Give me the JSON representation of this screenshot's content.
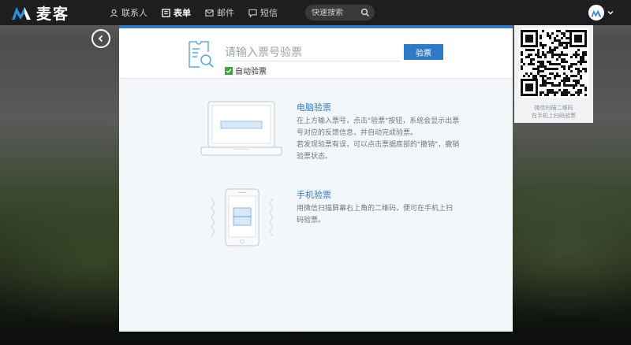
{
  "brand": {
    "name": "麦客"
  },
  "nav": [
    {
      "label": "联系人",
      "icon": "user-icon",
      "active": false
    },
    {
      "label": "表单",
      "icon": "form-icon",
      "active": true
    },
    {
      "label": "邮件",
      "icon": "mail-icon",
      "active": false
    },
    {
      "label": "短信",
      "icon": "message-icon",
      "active": false
    }
  ],
  "search": {
    "placeholder": "快速搜索"
  },
  "verify": {
    "placeholder": "请输入票号验票",
    "button_label": "验票",
    "auto_label": "自动验票"
  },
  "pc_section": {
    "title": "电脑验票",
    "line1": "在上方输入票号，点击\"验票\"按钮，系统会显示出票",
    "line2": "号对应的反馈信息，并自动完成验票。",
    "line3": "若发现验票有误，可以点击票据底部的\"撤销\"，撤销",
    "line4": "验票状态。"
  },
  "mobile_section": {
    "title": "手机验票",
    "line1": "用微信扫描屏幕右上角的二维码，便可在手机上扫",
    "line2": "码验票。"
  },
  "qr": {
    "line1": "微信扫描二维码",
    "line2": "在手机上扫码验票"
  },
  "colors": {
    "accent": "#2d7ac9",
    "check": "#3aa73a",
    "topbar": "#191919"
  }
}
